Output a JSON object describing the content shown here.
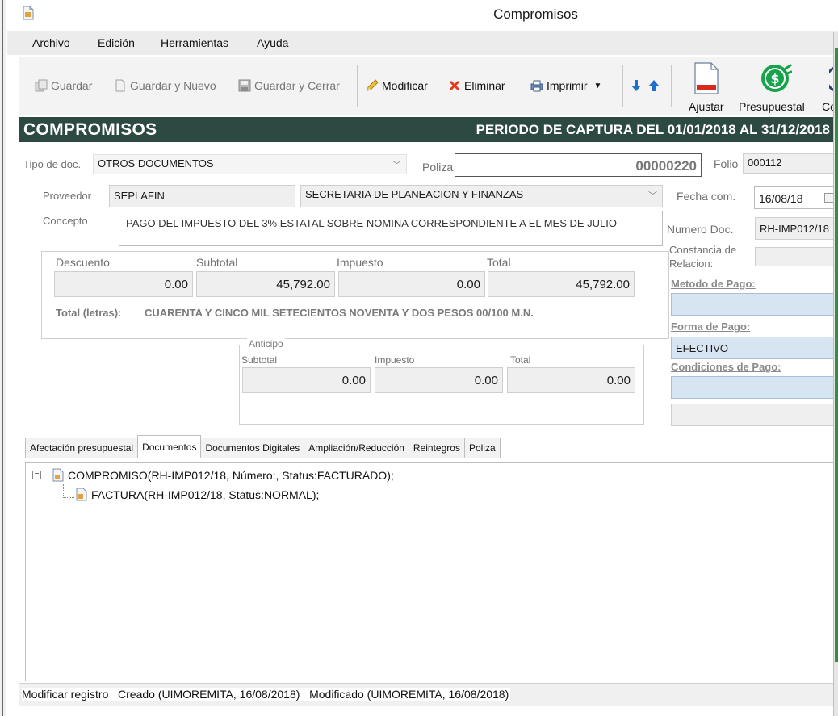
{
  "window": {
    "title": "Compromisos"
  },
  "menu": [
    {
      "label": "Archivo"
    },
    {
      "label": "Edición"
    },
    {
      "label": "Herramientas"
    },
    {
      "label": "Ayuda"
    }
  ],
  "toolbar": {
    "guardar": "Guardar",
    "guardar_nuevo": "Guardar y Nuevo",
    "guardar_cerrar": "Guardar y Cerrar",
    "modificar": "Modificar",
    "eliminar": "Eliminar",
    "imprimir": "Imprimir",
    "ajustar": "Ajustar",
    "presupuestal": "Presupuestal",
    "co": "Co"
  },
  "banner": {
    "title": "COMPROMISOS",
    "periodo": "PERIODO DE CAPTURA DEL 01/01/2018 AL 31/12/2018"
  },
  "form": {
    "tipo_doc_label": "Tipo de doc.",
    "tipo_doc_value": "OTROS DOCUMENTOS",
    "poliza_label": "Poliza",
    "poliza_value": "00000220",
    "folio_label": "Folio",
    "folio_value": "000112",
    "proveedor_label": "Proveedor",
    "proveedor_code": "SEPLAFIN",
    "proveedor_name": "SECRETARIA DE PLANEACION Y FINANZAS",
    "fecha_label": "Fecha com.",
    "fecha_value": "16/08/18",
    "concepto_label": "Concepto",
    "concepto_value": "PAGO DEL IMPUESTO DEL 3% ESTATAL SOBRE NOMINA CORRESPONDIENTE A EL MES DE JULIO",
    "numero_doc_label": "Numero Doc.",
    "numero_doc_value": "RH-IMP012/18",
    "constancia_label_1": "Constancia de",
    "constancia_label_2": "Relacion:",
    "metodo_pago_label": "Metodo de Pago:",
    "forma_pago_label": "Forma de Pago:",
    "forma_pago_value": "EFECTIVO",
    "condiciones_pago_label": "Condiciones de Pago:"
  },
  "totals": {
    "descuento_label": "Descuento",
    "descuento_value": "0.00",
    "subtotal_label": "Subtotal",
    "subtotal_value": "45,792.00",
    "impuesto_label": "Impuesto",
    "impuesto_value": "0.00",
    "total_label": "Total",
    "total_value": "45,792.00",
    "letras_label": "Total (letras):",
    "letras_value": "CUARENTA Y CINCO MIL SETECIENTOS NOVENTA Y DOS PESOS 00/100 M.N."
  },
  "anticipo": {
    "title": "Anticipo",
    "subtotal_label": "Subtotal",
    "subtotal_value": "0.00",
    "impuesto_label": "Impuesto",
    "impuesto_value": "0.00",
    "total_label": "Total",
    "total_value": "0.00"
  },
  "tabs": [
    {
      "label": "Afectación presupuestal",
      "active": false
    },
    {
      "label": "Documentos",
      "active": true
    },
    {
      "label": "Documentos Digitales",
      "active": false
    },
    {
      "label": "Ampliación/Reducción",
      "active": false
    },
    {
      "label": "Reintegros",
      "active": false
    },
    {
      "label": "Poliza",
      "active": false
    }
  ],
  "tree": {
    "expander": "−",
    "root": "COMPROMISO(RH-IMP012/18, Número:, Status:FACTURADO);",
    "child": "FACTURA(RH-IMP012/18, Status:NORMAL);"
  },
  "status": {
    "text": "Modificar registro   Creado (UIMOREMITA, 16/08/2018)   Modificado (UIMOREMITA, 16/08/2018)"
  },
  "colors": {
    "banner": "#2d4a42",
    "blue_field": "#d7e4f2",
    "delete_red": "#e03a1e",
    "arrow_blue": "#1f6fd0",
    "presupuestal_green": "#17a34a"
  }
}
